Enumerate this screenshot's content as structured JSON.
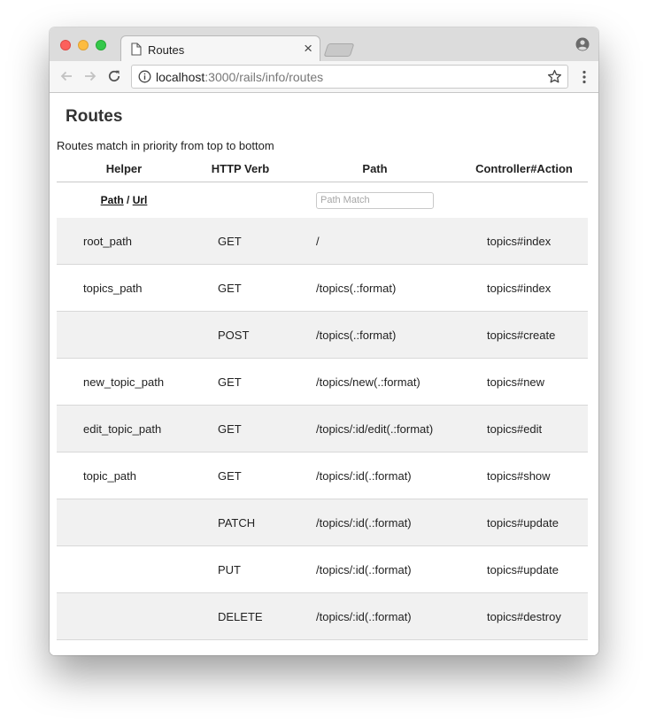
{
  "browser": {
    "tab_title": "Routes",
    "url_host": "localhost",
    "url_rest": ":3000/rails/info/routes"
  },
  "page": {
    "title": "Routes",
    "subtitle": "Routes match in priority from top to bottom"
  },
  "table": {
    "headers": [
      "Helper",
      "HTTP Verb",
      "Path",
      "Controller#Action"
    ],
    "filter": {
      "path_label": "Path",
      "separator": "/",
      "url_label": "Url",
      "search_placeholder": "Path Match"
    },
    "rows": [
      {
        "helper": "root_path",
        "verb": "GET",
        "path": "/",
        "action": "topics#index"
      },
      {
        "helper": "topics_path",
        "verb": "GET",
        "path": "/topics(.:format)",
        "action": "topics#index"
      },
      {
        "helper": "",
        "verb": "POST",
        "path": "/topics(.:format)",
        "action": "topics#create"
      },
      {
        "helper": "new_topic_path",
        "verb": "GET",
        "path": "/topics/new(.:format)",
        "action": "topics#new"
      },
      {
        "helper": "edit_topic_path",
        "verb": "GET",
        "path": "/topics/:id/edit(.:format)",
        "action": "topics#edit"
      },
      {
        "helper": "topic_path",
        "verb": "GET",
        "path": "/topics/:id(.:format)",
        "action": "topics#show"
      },
      {
        "helper": "",
        "verb": "PATCH",
        "path": "/topics/:id(.:format)",
        "action": "topics#update"
      },
      {
        "helper": "",
        "verb": "PUT",
        "path": "/topics/:id(.:format)",
        "action": "topics#update"
      },
      {
        "helper": "",
        "verb": "DELETE",
        "path": "/topics/:id(.:format)",
        "action": "topics#destroy"
      }
    ]
  },
  "icons": {
    "tab": "document-icon",
    "close": "close-icon",
    "back": "back-arrow-icon",
    "forward": "forward-arrow-icon",
    "reload": "reload-icon",
    "info": "info-icon",
    "bookmark": "star-icon",
    "menu": "kebab-menu-icon",
    "profile": "profile-icon"
  },
  "colors": {
    "titlebar": "#dcdcdc",
    "row_alt": "#f1f1f1",
    "close_light": "#fc605c",
    "minimize_light": "#fdbc40",
    "zoom_light": "#34c84a"
  }
}
